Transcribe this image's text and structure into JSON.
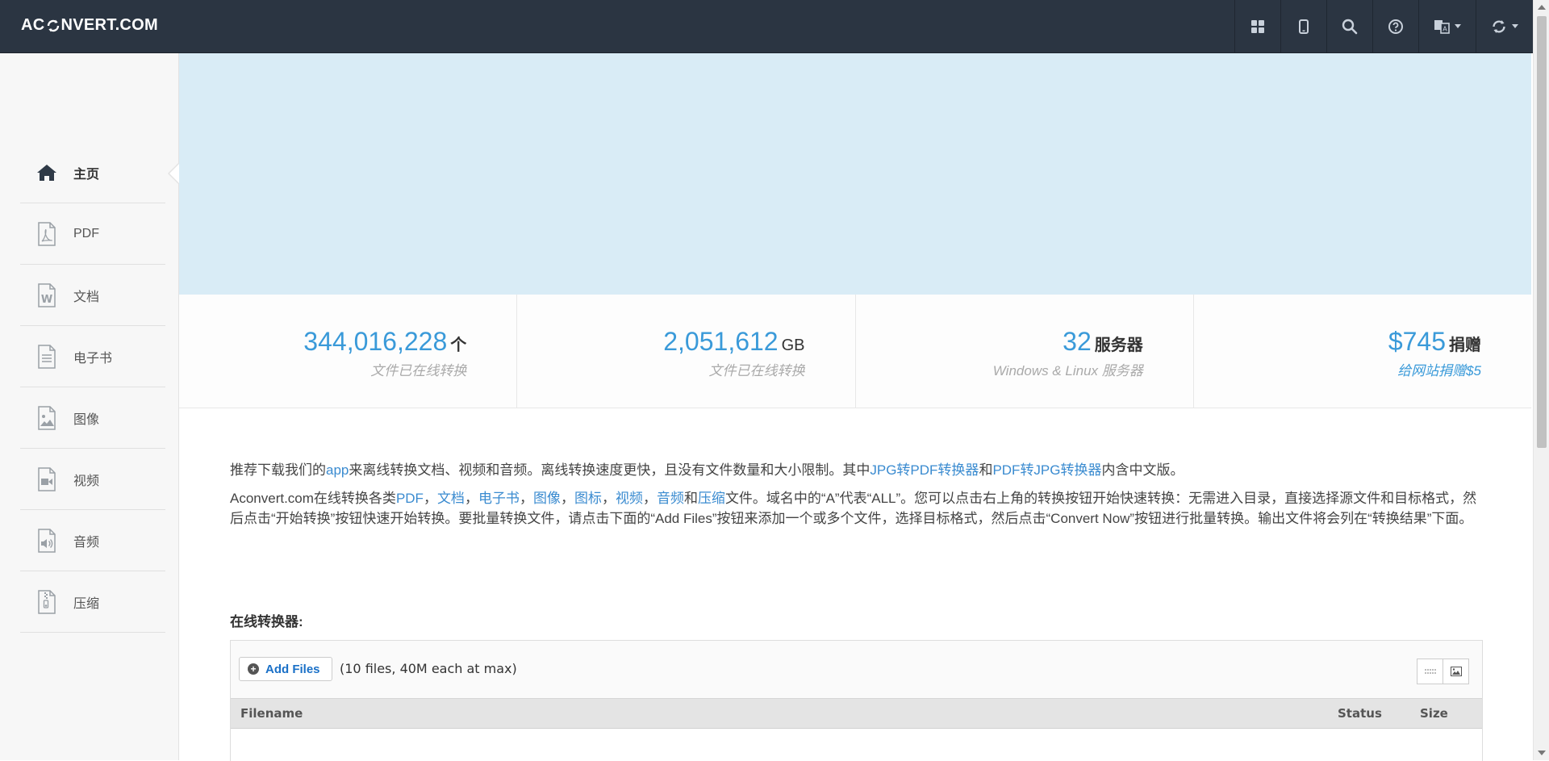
{
  "header": {
    "logo_prefix": "AC",
    "logo_suffix": "NVERT.COM",
    "buttons": [
      {
        "name": "apps-grid-icon"
      },
      {
        "name": "mobile-icon"
      },
      {
        "name": "search-icon"
      },
      {
        "name": "help-icon"
      },
      {
        "name": "language-icon",
        "dropdown": true
      },
      {
        "name": "convert-refresh-icon",
        "dropdown": true
      }
    ]
  },
  "sidebar": {
    "items": [
      {
        "label": "主页",
        "icon": "home-icon",
        "active": true
      },
      {
        "label": "PDF",
        "icon": "pdf-file-icon"
      },
      {
        "label": "文档",
        "icon": "word-file-icon"
      },
      {
        "label": "电子书",
        "icon": "ebook-file-icon"
      },
      {
        "label": "图像",
        "icon": "image-file-icon"
      },
      {
        "label": "视频",
        "icon": "video-file-icon"
      },
      {
        "label": "音频",
        "icon": "audio-file-icon"
      },
      {
        "label": "压缩",
        "icon": "archive-file-icon"
      }
    ]
  },
  "stats": [
    {
      "value": "344,016,228",
      "unit": "个",
      "caption": "文件已在线转换"
    },
    {
      "value": "2,051,612",
      "unit": "GB",
      "caption": "文件已在线转换"
    },
    {
      "value": "32",
      "unit": "服务器",
      "caption": "Windows & Linux 服务器"
    },
    {
      "value": "$745",
      "unit": "捐赠",
      "caption": "给网站捐赠$5"
    }
  ],
  "intro": {
    "p1_a": "推荐下载我们的",
    "p1_link_app": "app",
    "p1_b": "来离线转换文档、视频和音频。离线转换速度更快，且没有文件数量和大小限制。其中",
    "p1_link_jpg2pdf": "JPG转PDF转换器",
    "p1_c": "和",
    "p1_link_pdf2jpg": "PDF转JPG转换器",
    "p1_d": "内含中文版。",
    "p2_a": "Aconvert.com在线转换各类",
    "p2_links": [
      "PDF",
      "文档",
      "电子书",
      "图像",
      "图标",
      "视频",
      "音频"
    ],
    "p2_sep": "，",
    "p2_and": "和",
    "p2_link_last": "压缩",
    "p2_b": "文件。域名中的“A”代表“ALL”。您可以点击右上角的转换按钮开始快速转换：无需进入目录，直接选择源文件和目标格式，然后点击“开始转换”按钮快速开始转换。要批量转换文件，请点击下面的“Add Files”按钮来添加一个或多个文件，选择目标格式，然后点击“Convert Now”按钮进行批量转换。输出文件将会列在“转换结果”下面。"
  },
  "converter": {
    "title": "在线转换器:",
    "add_files": "Add Files",
    "limit_note": "(10 files, 40M each at max)",
    "columns": {
      "filename": "Filename",
      "status": "Status",
      "size": "Size"
    }
  },
  "colors": {
    "topbar": "#2b3542",
    "accent": "#3a9ad9",
    "banner": "#d9ecf6",
    "link": "#3a8bd0"
  }
}
